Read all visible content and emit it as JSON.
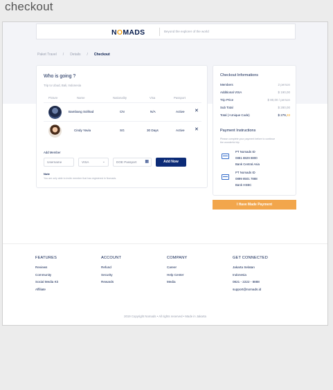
{
  "page": {
    "heading": "checkout"
  },
  "navbar": {
    "logo_prefix": "N",
    "logo_o": "O",
    "logo_suffix": "MADS",
    "tagline": "Beyond the explorer of the world"
  },
  "breadcrumb": {
    "items": [
      "Paket Travel",
      "Details",
      "Checkout"
    ],
    "separator": "/"
  },
  "trip": {
    "title": "Who is going ?",
    "subtitle": "Trip to Ubud, Bali, Indonesia",
    "columns": [
      "Picture",
      "Name",
      "Nationality",
      "Visa",
      "Passport"
    ],
    "travelers": [
      {
        "name": "Bambang Solihad",
        "nationality": "CN",
        "visa": "N/A",
        "passport": "Active"
      },
      {
        "name": "Cindy Yavia",
        "nationality": "SG",
        "visa": "30 Days",
        "passport": "Active"
      }
    ],
    "add_member_label": "Add Member",
    "username_placeholder": "Username",
    "visa_value": "VISA",
    "doe_placeholder": "DOE Passport",
    "add_now_label": "Add Now",
    "note_title": "Note",
    "note_text": "You are only able to invite member that has registered in Nomads."
  },
  "checkout": {
    "title": "Checkout Informations",
    "rows": [
      {
        "key": "Members",
        "value": "2 person"
      },
      {
        "key": "Additional VISA",
        "value": "$ 190,00"
      },
      {
        "key": "Trip Price",
        "value": "$ 80,00 / person"
      },
      {
        "key": "Sub Total",
        "value": "$ 280,00"
      }
    ],
    "total_label": "Total (+Unique Code)",
    "total_value": "$ 279,",
    "total_unique": "33"
  },
  "payment": {
    "title": "Payment Instructions",
    "desc": "Please complete your payment before to continue the wonderful trip",
    "accounts": [
      {
        "name": "PT Nomads ID",
        "number": "0881 8829 8800",
        "bank": "Bank Central Asia"
      },
      {
        "name": "PT Nomads ID",
        "number": "0899 8501 7888",
        "bank": "Bank HSBC"
      }
    ],
    "button_label": "I Have Made Payment"
  },
  "footer": {
    "columns": [
      {
        "heading": "FEATURES",
        "links": [
          "Reviews",
          "Community",
          "Social Media Kit",
          "Affiliate"
        ]
      },
      {
        "heading": "ACCOUNT",
        "links": [
          "Refund",
          "Security",
          "Rewards"
        ]
      },
      {
        "heading": "COMPANY",
        "links": [
          "Career",
          "Help Center",
          "Media"
        ]
      },
      {
        "heading": "GET CONNECTED",
        "links": [
          "Jakarta Selatan",
          "Indonesia",
          "0821 - 2222 - 8888",
          "support@nomads.id"
        ]
      }
    ],
    "copyright": "2019 Copyright Nomads • All rights reserved • Made in Jakarta"
  },
  "icons": {
    "remove": "close-icon",
    "calendar": "calendar-icon",
    "bank": "bank-card-icon",
    "dropdown": "chevron-down-icon"
  }
}
